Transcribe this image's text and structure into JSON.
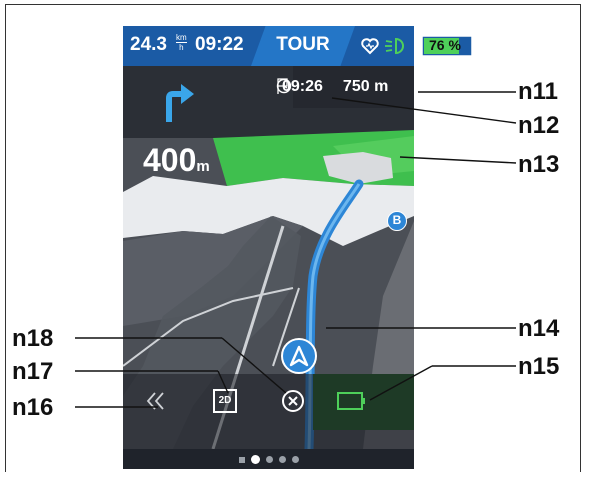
{
  "status_bar": {
    "speed": "24.3",
    "speed_unit_top": "km",
    "speed_unit_bottom": "h",
    "time": "09:22",
    "mode": "TOUR",
    "battery_percent": "76 %",
    "battery_level": 0.76
  },
  "navigation": {
    "turn_distance_value": "400",
    "turn_distance_unit": "m",
    "arrival_time": "09:26",
    "remaining_distance": "750 m",
    "destination_marker_label": "B"
  },
  "bottom_bar": {
    "view_mode_label": "2D"
  },
  "pager": {
    "count": 5,
    "active_index": 1
  },
  "callouts": [
    "n11",
    "n12",
    "n13",
    "n14",
    "n15",
    "n16",
    "n17",
    "n18"
  ],
  "colors": {
    "status_bar": "#1b5ba5",
    "mode_highlight": "#2476c7",
    "route": "#2d86d6",
    "green_area": "#3fbf4e",
    "battery_indicator": "#4ed05a"
  },
  "icons": {
    "turn": "turn-right-arrow-icon",
    "clock": "clock-icon",
    "flag": "flag-icon",
    "back": "double-chevron-left-icon",
    "cancel": "close-circle-icon",
    "battery": "battery-outline-icon",
    "heart": "heart-icon",
    "light": "headlight-icon"
  }
}
